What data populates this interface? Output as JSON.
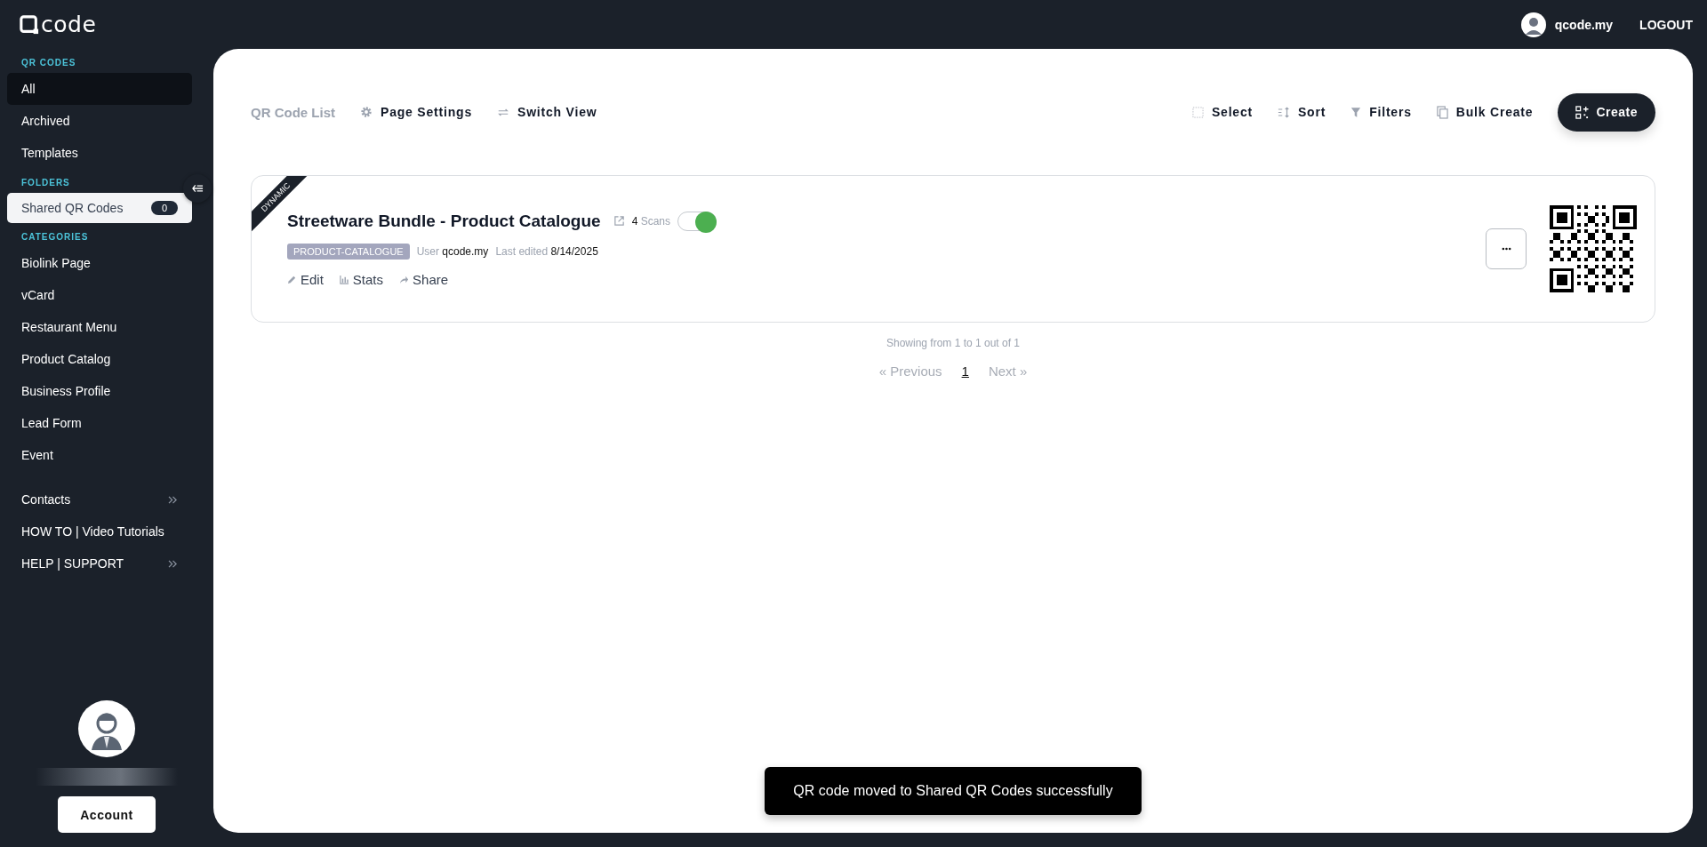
{
  "logo": {
    "text": "code"
  },
  "user": {
    "name": "qcode.my"
  },
  "logout": "LOGOUT",
  "sidebar": {
    "qr_codes": {
      "heading": "QR CODES",
      "items": [
        {
          "label": "All",
          "selected": true
        },
        {
          "label": "Archived",
          "selected": false
        },
        {
          "label": "Templates",
          "selected": false
        }
      ]
    },
    "folders": {
      "heading": "FOLDERS",
      "items": [
        {
          "label": "Shared QR Codes",
          "count": "0",
          "highlighted": true
        }
      ]
    },
    "categories": {
      "heading": "CATEGORIES",
      "items": [
        "Biolink Page",
        "vCard",
        "Restaurant Menu",
        "Product Catalog",
        "Business Profile",
        "Lead Form",
        "Event"
      ]
    },
    "links": [
      {
        "label": "Contacts",
        "has_arrow": true
      },
      {
        "label": "HOW TO | Video Tutorials",
        "has_arrow": false
      },
      {
        "label": "HELP | SUPPORT",
        "has_arrow": true
      }
    ],
    "account_button": "Account"
  },
  "toolbar": {
    "title": "QR Code List",
    "left_actions": [
      {
        "kind": "settings",
        "label": "Page Settings"
      },
      {
        "kind": "switch",
        "label": "Switch View"
      }
    ],
    "right_actions": [
      {
        "kind": "select",
        "label": "Select"
      },
      {
        "kind": "sort",
        "label": "Sort"
      },
      {
        "kind": "filter",
        "label": "Filters"
      },
      {
        "kind": "copy",
        "label": "Bulk Create"
      }
    ],
    "create_button": "Create"
  },
  "card": {
    "ribbon": "DYNAMIC",
    "title": "Streetware Bundle - Product Catalogue",
    "scans_count": "4",
    "scans_label": "Scans",
    "active": true,
    "tag": "PRODUCT-CATALOGUE",
    "user_label": "User",
    "user": "qcode.my",
    "edited_label": "Last edited",
    "edited": "8/14/2025",
    "actions": [
      {
        "kind": "edit",
        "label": "Edit"
      },
      {
        "kind": "stats",
        "label": "Stats"
      },
      {
        "kind": "share",
        "label": "Share"
      }
    ]
  },
  "pagination": {
    "summary": "Showing from 1 to 1 out of 1",
    "previous": {
      "label": "« Previous",
      "disabled": true
    },
    "pages": [
      {
        "label": "1",
        "selected": true
      }
    ],
    "next": {
      "label": "Next »",
      "disabled": true
    }
  },
  "toast": "QR code moved to Shared QR Codes successfully"
}
